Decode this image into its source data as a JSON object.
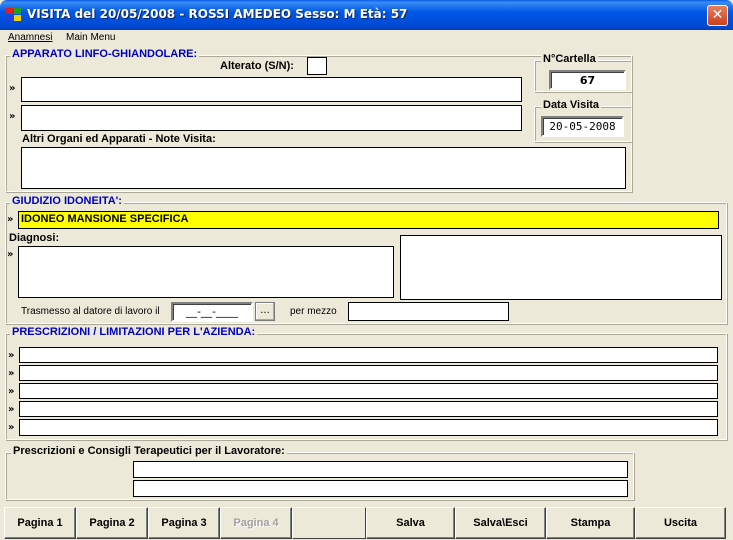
{
  "window": {
    "title": "VISITA del 20/05/2008  -  ROSSI AMEDEO Sesso: M Età: 57",
    "close_glyph": "✕"
  },
  "menu": [
    {
      "label": "Anamnesi",
      "mnemonic_index": 0
    },
    {
      "label": "Main Menu",
      "mnemonic_index": 0
    }
  ],
  "apparato": {
    "title": "APPARATO LINFO-GHIANDOLARE:",
    "alterato_label": "Alterato (S/N):",
    "alterato_value": "",
    "line1_value": "",
    "line2_value": "",
    "note_label": "Altri Organi ed Apparati - Note Visita:",
    "note_value": ""
  },
  "cartella": {
    "title": "N°Cartella",
    "value": "67"
  },
  "data_visita": {
    "title": "Data Visita",
    "value": "20-05-2008"
  },
  "giudizio": {
    "title": "GIUDIZIO IDONEITA':",
    "value": "IDONEO MANSIONE SPECIFICA",
    "diagnosi_label": "Diagnosi:",
    "diagnosi_value": "",
    "right_value": "",
    "trasmesso_label": "Trasmesso al datore di lavoro il",
    "trasmesso_value": "__-__-____",
    "date_button": "...",
    "per_mezzo_label": "per mezzo",
    "per_mezzo_value": ""
  },
  "prescrizioni": {
    "title": "PRESCRIZIONI / LIMITAZIONI PER L'AZIENDA:",
    "rows": [
      "",
      "",
      "",
      "",
      ""
    ]
  },
  "consigli": {
    "title": "Prescrizioni e Consigli Terapeutici per il Lavoratore:",
    "rows": [
      "",
      ""
    ]
  },
  "chevron_glyph": "»",
  "buttons": {
    "pagina1": "Pagina 1",
    "pagina2": "Pagina 2",
    "pagina3": "Pagina 3",
    "pagina4": "Pagina 4",
    "salva": "Salva",
    "salva_esci": "Salva\\Esci",
    "stampa": "Stampa",
    "uscita": "Uscita"
  },
  "colors": {
    "title_bar": "#0054e3",
    "group_title": "#0000c0",
    "highlight": "#ffff00",
    "window_bg": "#ece9d8"
  }
}
